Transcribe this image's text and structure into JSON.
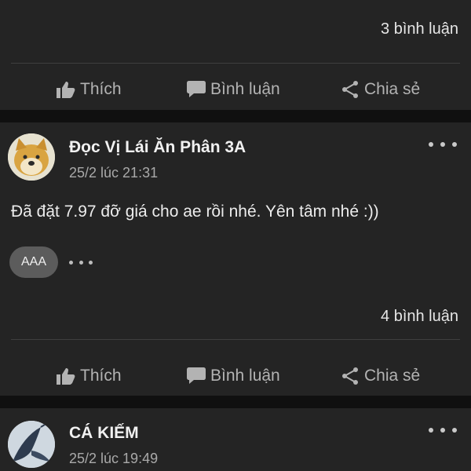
{
  "post_top": {
    "comment_count": "3 bình luận",
    "actions": {
      "like": "Thích",
      "comment": "Bình luận",
      "share": "Chia sẻ"
    }
  },
  "post_main": {
    "author": "Đọc Vị Lái Ăn Phân 3A",
    "time": "25/2 lúc 21:31",
    "text": "Đã đặt 7.97 đỡ giá cho ae rồi nhé. Yên tâm nhé :))",
    "reactor_label": "AAA",
    "comment_count": "4 bình luận",
    "actions": {
      "like": "Thích",
      "comment": "Bình luận",
      "share": "Chia sẻ"
    }
  },
  "post_bottom": {
    "author": "CÁ KIẾM",
    "time": "25/2 lúc 19:49"
  },
  "colors": {
    "background": "#101010",
    "card": "#242424",
    "action_text": "#b3b3b3",
    "chip": "#5c5c5c"
  }
}
